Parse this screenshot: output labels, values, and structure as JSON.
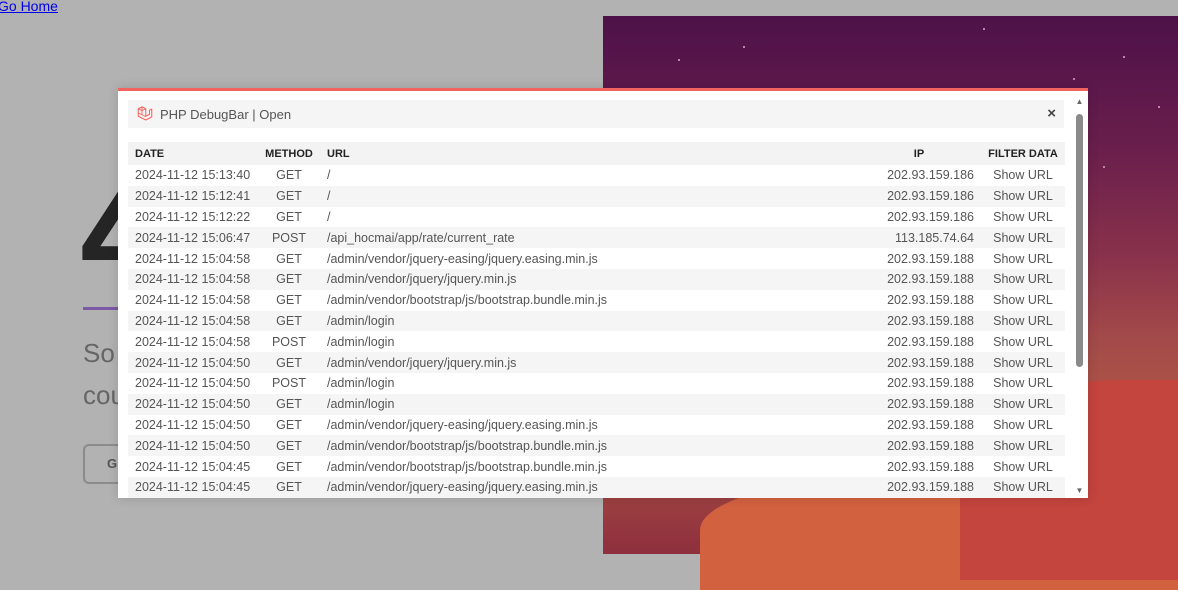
{
  "page": {
    "go_home": "Go Home"
  },
  "background": {
    "big_char": "4",
    "line1": "So",
    "line2": "cou",
    "button": "G"
  },
  "modal": {
    "title": "PHP DebugBar | Open",
    "close": "×",
    "columns": {
      "date": "DATE",
      "method": "METHOD",
      "url": "URL",
      "ip": "IP",
      "filter": "FILTER DATA"
    },
    "rows": [
      {
        "date": "2024-11-12 15:13:40",
        "method": "GET",
        "url": "/",
        "ip": "202.93.159.186",
        "action": "Show URL"
      },
      {
        "date": "2024-11-12 15:12:41",
        "method": "GET",
        "url": "/",
        "ip": "202.93.159.186",
        "action": "Show URL"
      },
      {
        "date": "2024-11-12 15:12:22",
        "method": "GET",
        "url": "/",
        "ip": "202.93.159.186",
        "action": "Show URL"
      },
      {
        "date": "2024-11-12 15:06:47",
        "method": "POST",
        "url": "/api_hocmai/app/rate/current_rate",
        "ip": "113.185.74.64",
        "action": "Show URL"
      },
      {
        "date": "2024-11-12 15:04:58",
        "method": "GET",
        "url": "/admin/vendor/jquery-easing/jquery.easing.min.js",
        "ip": "202.93.159.188",
        "action": "Show URL"
      },
      {
        "date": "2024-11-12 15:04:58",
        "method": "GET",
        "url": "/admin/vendor/jquery/jquery.min.js",
        "ip": "202.93.159.188",
        "action": "Show URL"
      },
      {
        "date": "2024-11-12 15:04:58",
        "method": "GET",
        "url": "/admin/vendor/bootstrap/js/bootstrap.bundle.min.js",
        "ip": "202.93.159.188",
        "action": "Show URL"
      },
      {
        "date": "2024-11-12 15:04:58",
        "method": "GET",
        "url": "/admin/login",
        "ip": "202.93.159.188",
        "action": "Show URL"
      },
      {
        "date": "2024-11-12 15:04:58",
        "method": "POST",
        "url": "/admin/login",
        "ip": "202.93.159.188",
        "action": "Show URL"
      },
      {
        "date": "2024-11-12 15:04:50",
        "method": "GET",
        "url": "/admin/vendor/jquery/jquery.min.js",
        "ip": "202.93.159.188",
        "action": "Show URL"
      },
      {
        "date": "2024-11-12 15:04:50",
        "method": "POST",
        "url": "/admin/login",
        "ip": "202.93.159.188",
        "action": "Show URL"
      },
      {
        "date": "2024-11-12 15:04:50",
        "method": "GET",
        "url": "/admin/login",
        "ip": "202.93.159.188",
        "action": "Show URL"
      },
      {
        "date": "2024-11-12 15:04:50",
        "method": "GET",
        "url": "/admin/vendor/jquery-easing/jquery.easing.min.js",
        "ip": "202.93.159.188",
        "action": "Show URL"
      },
      {
        "date": "2024-11-12 15:04:50",
        "method": "GET",
        "url": "/admin/vendor/bootstrap/js/bootstrap.bundle.min.js",
        "ip": "202.93.159.188",
        "action": "Show URL"
      },
      {
        "date": "2024-11-12 15:04:45",
        "method": "GET",
        "url": "/admin/vendor/bootstrap/js/bootstrap.bundle.min.js",
        "ip": "202.93.159.188",
        "action": "Show URL"
      },
      {
        "date": "2024-11-12 15:04:45",
        "method": "GET",
        "url": "/admin/vendor/jquery-easing/jquery.easing.min.js",
        "ip": "202.93.159.188",
        "action": "Show URL"
      }
    ]
  },
  "colors": {
    "accent": "#f4645f",
    "logo": "#f4645f"
  },
  "icons": {
    "logo": "laravel-logo-icon",
    "close": "close-icon",
    "scroll_up": "scroll-up-arrow-icon",
    "scroll_down": "scroll-down-arrow-icon"
  }
}
